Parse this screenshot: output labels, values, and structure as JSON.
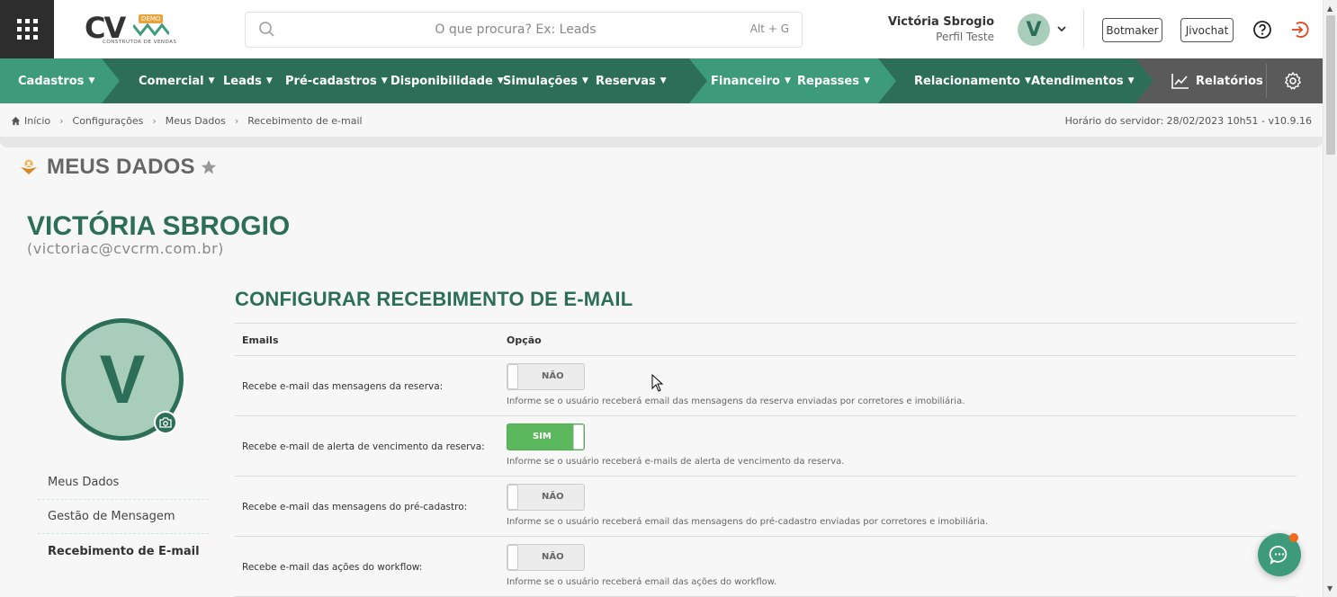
{
  "header": {
    "logo": {
      "text": "CV",
      "badge": "DEMO",
      "subtitle": "CONSTRUTOR DE VENDAS"
    },
    "search": {
      "placeholder": "O que procura? Ex: Leads",
      "shortcut": "Alt + G"
    },
    "user": {
      "name": "Victória Sbrogio",
      "profile": "Perfil Teste",
      "initial": "V"
    },
    "buttons": {
      "botmaker": "Botmaker",
      "jivochat": "Jivochat"
    }
  },
  "nav": {
    "items": [
      {
        "label": "Cadastros"
      },
      {
        "label": "Comercial"
      },
      {
        "label": "Leads"
      },
      {
        "label": "Pré-cadastros"
      },
      {
        "label": "Disponibilidade"
      },
      {
        "label": "Simulações"
      },
      {
        "label": "Reservas"
      },
      {
        "label": "Financeiro"
      },
      {
        "label": "Repasses"
      },
      {
        "label": "Relacionamento"
      },
      {
        "label": "Atendimentos"
      }
    ],
    "reports": "Relatórios",
    "colors": {
      "light": "#3d9b7b",
      "dark": "#2c6e58",
      "gray": "#5a5a5a"
    }
  },
  "breadcrumb": [
    "Início",
    "Configurações",
    "Meus Dados",
    "Recebimento de e-mail"
  ],
  "server_time": "Horário do servidor: 28/02/2023 10h51 - v10.9.16",
  "page": {
    "title": "MEUS DADOS",
    "profile_name": "VICTÓRIA SBROGIO",
    "profile_email": "(victoriac@cvcrm.com.br)",
    "avatar_initial": "V"
  },
  "side_menu": [
    {
      "label": "Meus Dados"
    },
    {
      "label": "Gestão de Mensagem"
    },
    {
      "label": "Recebimento de E-mail"
    }
  ],
  "config": {
    "title": "CONFIGURAR RECEBIMENTO DE E-MAIL",
    "columns": {
      "emails": "Emails",
      "option": "Opção"
    },
    "rows": [
      {
        "label": "Recebe e-mail das mensagens da reserva:",
        "value": "NÃO",
        "help": "Informe se o usuário receberá email das mensagens da reserva enviadas por corretores e imobiliária."
      },
      {
        "label": "Recebe e-mail de alerta de vencimento da reserva:",
        "value": "SIM",
        "help": "Informe se o usuário receberá e-mails de alerta de vencimento da reserva."
      },
      {
        "label": "Recebe e-mail das mensagens do pré-cadastro:",
        "value": "NÃO",
        "help": "Informe se o usuário receberá email das mensagens do pré-cadastro enviadas por corretores e imobiliária."
      },
      {
        "label": "Recebe e-mail das ações do workflow:",
        "value": "NÃO",
        "help": "Informe se o usuário receberá email das ações do workflow."
      }
    ]
  },
  "icons": [
    "apps-grid-icon",
    "search-icon",
    "chevron-down-icon",
    "help-icon",
    "logout-icon",
    "chart-line-icon",
    "gear-icon",
    "home-icon",
    "star-icon",
    "camera-icon",
    "chat-icon"
  ]
}
